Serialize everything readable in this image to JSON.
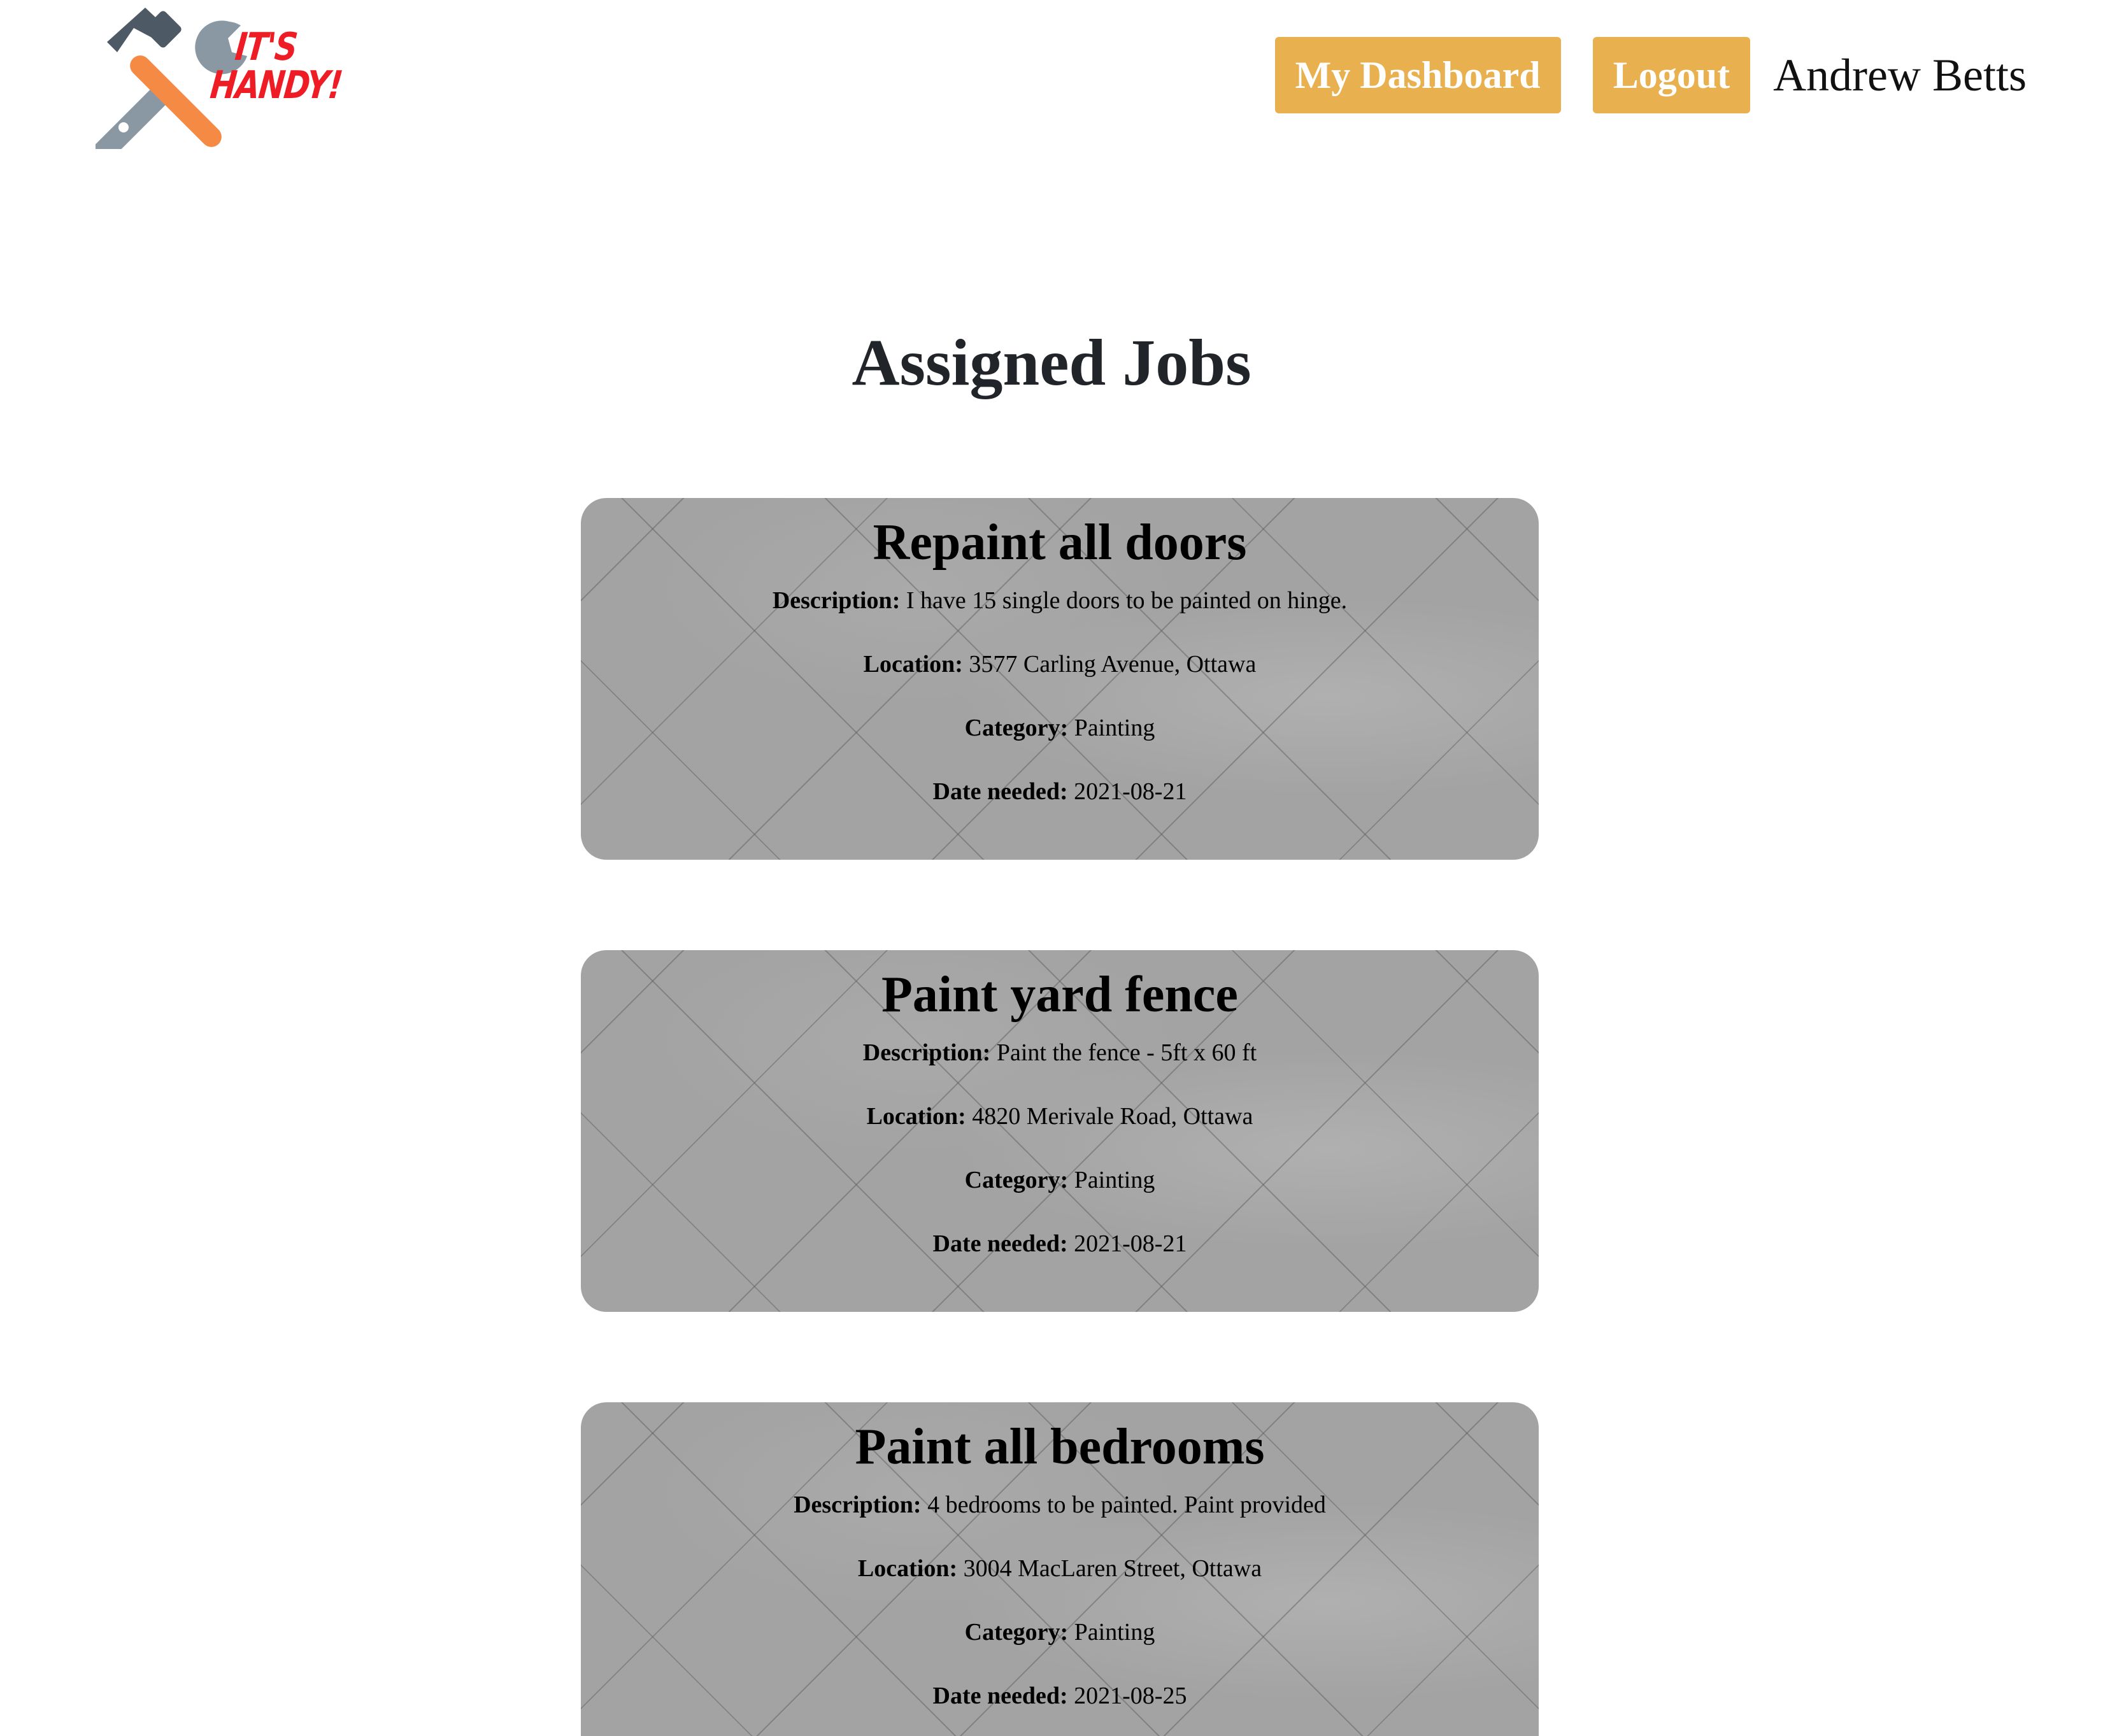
{
  "nav": {
    "logo_line1": "IT'S",
    "logo_line2": "HANDY!",
    "dashboard_label": "My Dashboard",
    "logout_label": "Logout",
    "user_name": "Andrew Betts"
  },
  "page_title": "Assigned Jobs",
  "labels": {
    "description": "Description:",
    "location": "Location:",
    "category": "Category:",
    "date_needed": "Date needed:"
  },
  "jobs": [
    {
      "title": "Repaint all doors",
      "description": "I have 15 single doors to be painted on hinge.",
      "location": "3577 Carling Avenue, Ottawa",
      "category": "Painting",
      "date_needed": "2021-08-21"
    },
    {
      "title": "Paint yard fence",
      "description": "Paint the fence - 5ft x 60 ft",
      "location": "4820 Merivale Road, Ottawa",
      "category": "Painting",
      "date_needed": "2021-08-21"
    },
    {
      "title": "Paint all bedrooms",
      "description": "4 bedrooms to be painted. Paint provided",
      "location": "3004 MacLaren Street, Ottawa",
      "category": "Painting",
      "date_needed": "2021-08-25"
    }
  ],
  "colors": {
    "nav_button": "#e8b04f",
    "logo_text": "#ee1c24",
    "card_bg": "#a3a3a3"
  }
}
